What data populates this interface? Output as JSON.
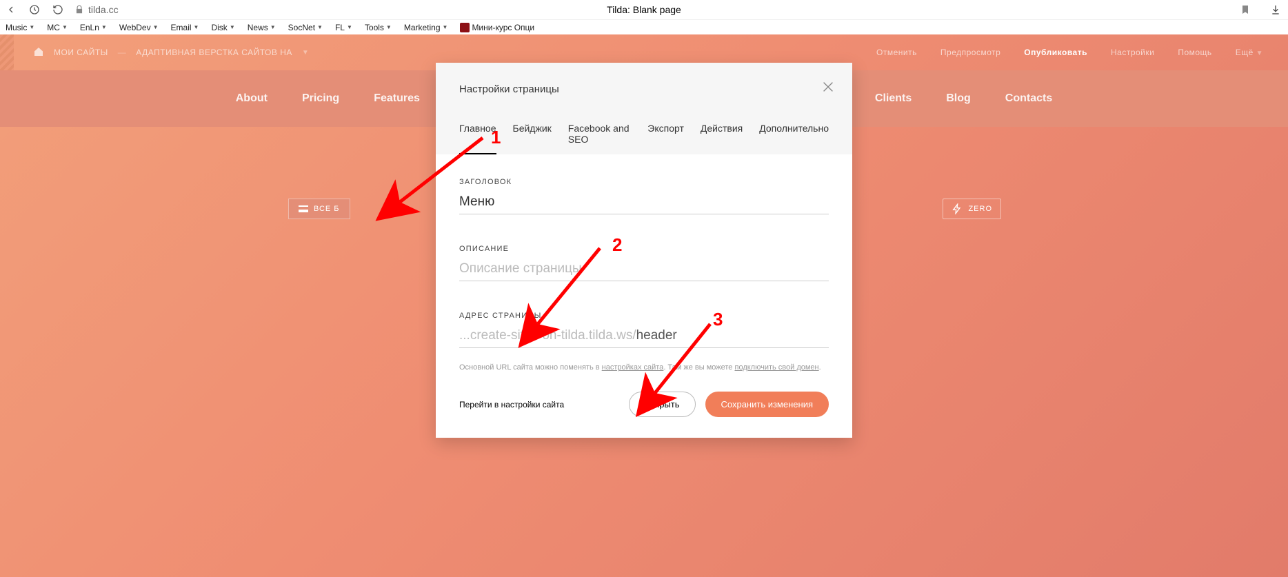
{
  "browser": {
    "url": "tilda.cc",
    "page_title": "Tilda: Blank page"
  },
  "bookmarks": [
    {
      "label": "Music"
    },
    {
      "label": "MC"
    },
    {
      "label": "EnLn"
    },
    {
      "label": "WebDev"
    },
    {
      "label": "Email"
    },
    {
      "label": "Disk"
    },
    {
      "label": "News"
    },
    {
      "label": "SocNet"
    },
    {
      "label": "FL"
    },
    {
      "label": "Tools"
    },
    {
      "label": "Marketing"
    }
  ],
  "bookmark_course": "Мини-курс Опци",
  "tilda_top": {
    "my_sites": "МОИ САЙТЫ",
    "project": "АДАПТИВНАЯ ВЕРСТКА САЙТОВ НА",
    "actions": {
      "cancel": "Отменить",
      "preview": "Предпросмотр",
      "publish": "Опубликовать",
      "settings": "Настройки",
      "help": "Помощь",
      "more": "Ещё"
    }
  },
  "site_nav": [
    "About",
    "Pricing",
    "Features",
    "Clients",
    "Blog",
    "Contacts"
  ],
  "all_blocks_btn": "ВСЕ Б",
  "zero_btn": "ZERO",
  "modal": {
    "title": "Настройки страницы",
    "tabs": [
      "Главное",
      "Бейджик",
      "Facebook and SEO",
      "Экспорт",
      "Действия",
      "Дополнительно"
    ],
    "fields": {
      "title_label": "ЗАГОЛОВОК",
      "title_value": "Меню",
      "desc_label": "ОПИСАНИЕ",
      "desc_placeholder": "Описание страницы",
      "url_label": "АДРЕС СТРАНИЦЫ",
      "url_prefix": "...create-sites-on-tilda.tilda.ws/",
      "url_value": "header",
      "url_hint_1": "Основной URL сайта можно поменять в ",
      "url_hint_link1": "настройках сайта",
      "url_hint_2": ". Там же вы можете ",
      "url_hint_link2": "подключить свой домен",
      "url_hint_3": "."
    },
    "footer": {
      "settings_link": "Перейти в настройки сайта",
      "close": "Закрыть",
      "save": "Сохранить изменения"
    }
  },
  "annotations": {
    "a1": "1",
    "a2": "2",
    "a3": "3"
  }
}
